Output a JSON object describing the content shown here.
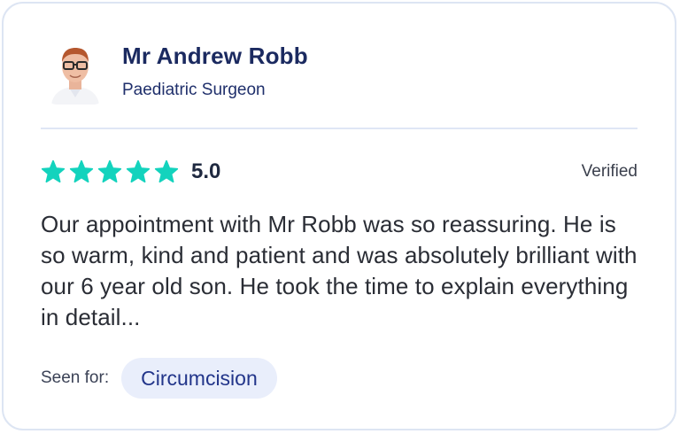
{
  "doctor": {
    "name": "Mr Andrew Robb",
    "specialty": "Paediatric Surgeon",
    "avatar_icon": "doctor-portrait"
  },
  "review": {
    "rating": 5,
    "rating_max": 5,
    "score_label": "5.0",
    "verified_label": "Verified",
    "text": "Our appointment with Mr Robb was so reassuring. He is so warm, kind and patient and was absolutely brilliant with our 6 year old son. He took the time to explain everything in detail...",
    "seen_for_label": "Seen for:",
    "procedure": "Circumcision"
  },
  "colors": {
    "star": "#13d3bd",
    "name": "#1b2a60",
    "pill_bg": "#e9eefb",
    "pill_text": "#22358a",
    "border": "#dde5f3"
  }
}
